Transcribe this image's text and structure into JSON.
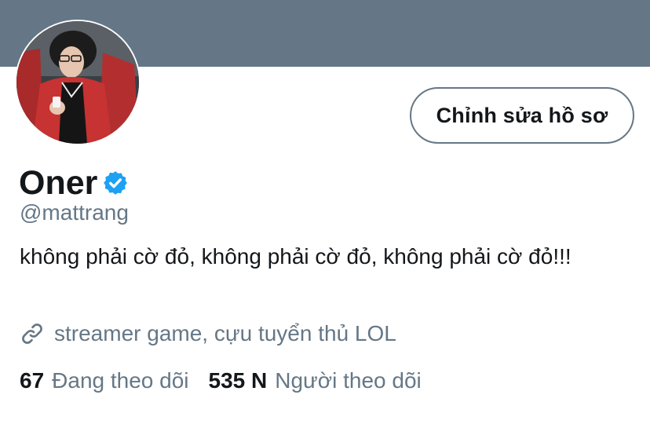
{
  "profile": {
    "display_name": "Oner",
    "handle": "@mattrang",
    "bio": "không phải cờ đỏ, không phải cờ đỏ, không phải cờ đỏ!!!",
    "url_text": "streamer game, cựu tuyển thủ LOL",
    "verified": true
  },
  "actions": {
    "edit_profile_label": "Chỉnh sửa hồ sơ"
  },
  "stats": {
    "following_count": "67",
    "following_label": "Đang theo dõi",
    "followers_count": "535 N",
    "followers_label": "Người theo dõi"
  },
  "colors": {
    "banner": "#657786",
    "text_primary": "#14171a",
    "text_secondary": "#657786",
    "verified_badge": "#1da1f2"
  },
  "icons": {
    "verified": "verified-badge-icon",
    "link": "link-icon"
  }
}
